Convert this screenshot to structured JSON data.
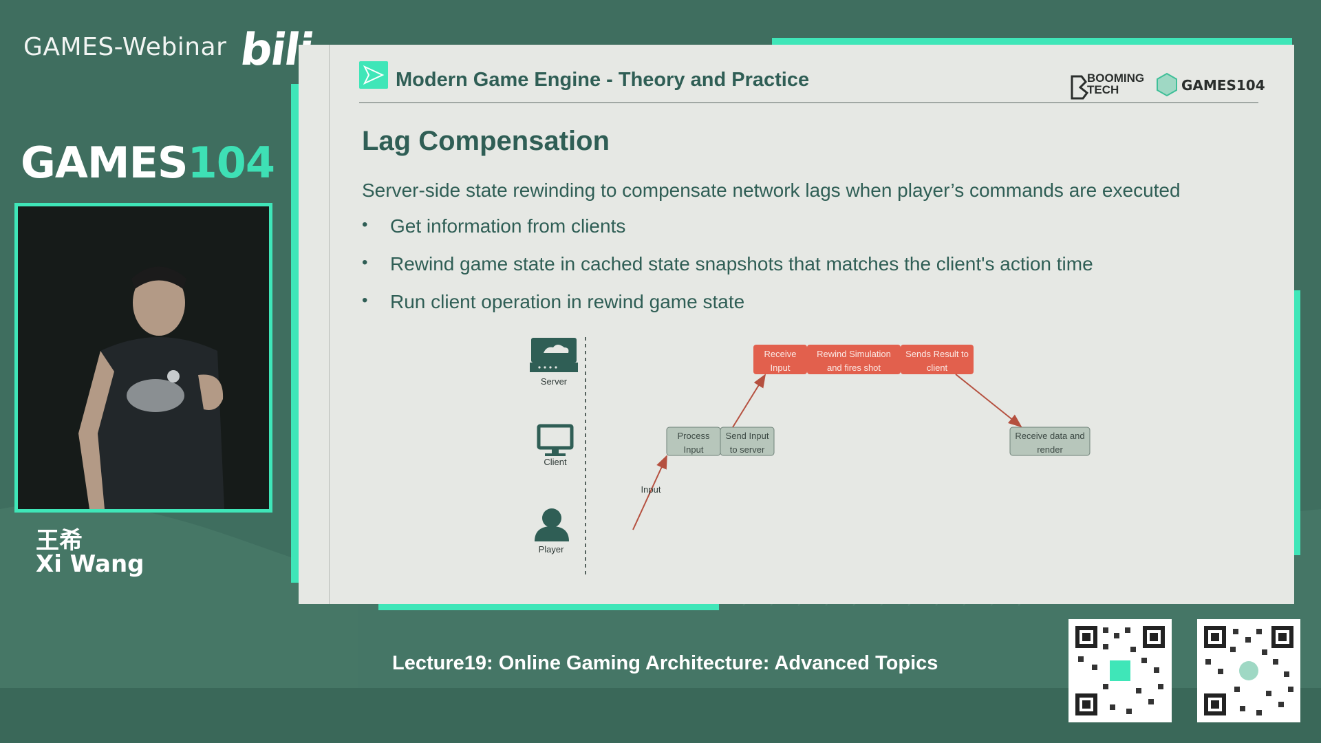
{
  "header": {
    "webinar_title": "GAMES-Webinar",
    "bilibili_logo": "bili"
  },
  "brand": {
    "name_part1": "GAMES",
    "name_part2": "104"
  },
  "speaker": {
    "name_cn": "王希",
    "name_en": "Xi Wang"
  },
  "slide": {
    "course_title": "Modern Game Engine - Theory and Practice",
    "logos": {
      "booming_line1": "BOOMING",
      "booming_line2": "TECH",
      "games104": "GAMES104"
    },
    "heading": "Lag Compensation",
    "intro": "Server-side state rewinding to compensate network lags when player’s commands are executed",
    "bullets": [
      "Get information from clients",
      "Rewind game state in cached state snapshots that matches the client's action time",
      "Run client operation in rewind game state"
    ],
    "diagram": {
      "actors": {
        "server": "Server",
        "client": "Client",
        "player": "Player"
      },
      "server_boxes": [
        {
          "line1": "Receive",
          "line2": "Input"
        },
        {
          "line1": "Rewind Simulation",
          "line2": "and fires shot"
        },
        {
          "line1": "Sends Result to",
          "line2": "client"
        }
      ],
      "client_boxes": [
        {
          "line1": "Process",
          "line2": "Input"
        },
        {
          "line1": "Send Input",
          "line2": "to server"
        },
        {
          "line1": "Receive data and",
          "line2": "render"
        }
      ],
      "input_label": "Input"
    }
  },
  "footer": {
    "lecture_title": "Lecture19: Online Gaming Architecture: Advanced Topics"
  },
  "colors": {
    "accent": "#3fe6b8",
    "background": "#3f6e5f",
    "server_box": "#e2604d",
    "client_box": "#b7c6bb",
    "text_dark": "#2f5e55"
  }
}
